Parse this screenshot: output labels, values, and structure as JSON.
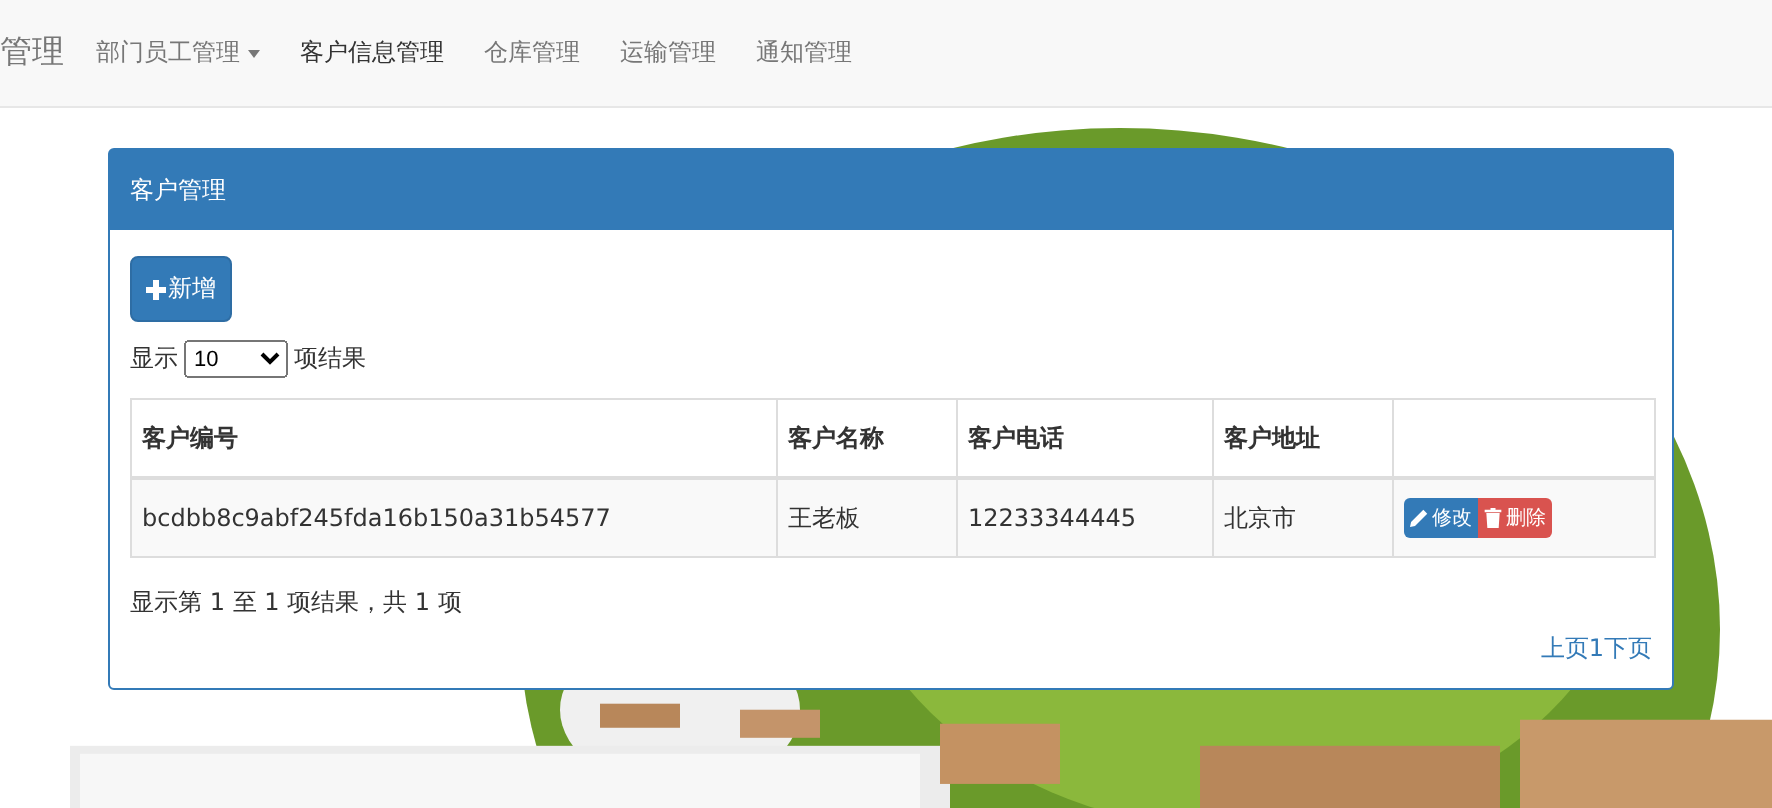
{
  "navbar": {
    "brand": "管理",
    "items": [
      {
        "label": "部门员工管理",
        "dropdown": true,
        "selected": false
      },
      {
        "label": "客户信息管理",
        "dropdown": false,
        "selected": true
      },
      {
        "label": "仓库管理",
        "dropdown": false,
        "selected": false
      },
      {
        "label": "运输管理",
        "dropdown": false,
        "selected": false
      },
      {
        "label": "通知管理",
        "dropdown": false,
        "selected": false
      }
    ]
  },
  "panel": {
    "title": "客户管理",
    "add_button": "新增",
    "length_prefix": "显示",
    "length_value": "10",
    "length_suffix": "项结果",
    "table": {
      "columns": [
        "客户编号",
        "客户名称",
        "客户电话",
        "客户地址"
      ],
      "rows": [
        {
          "cells": [
            "bcdbb8c9abf245fda16b150a31b54577",
            "王老板",
            "12233344445",
            "北京市"
          ],
          "edit": "修改",
          "delete": "删除"
        }
      ]
    },
    "info": "显示第 1 至 1 项结果，共 1 项",
    "pager": "上页1下页"
  }
}
